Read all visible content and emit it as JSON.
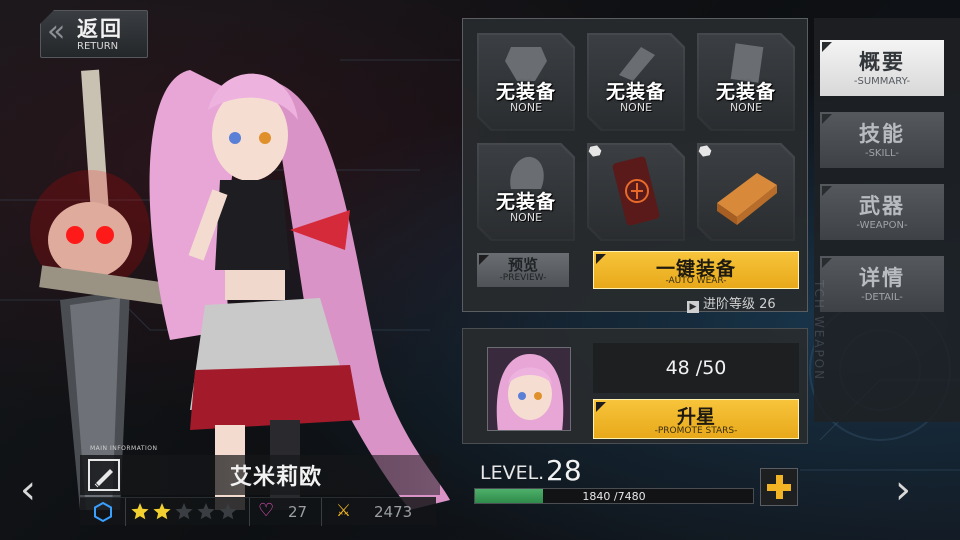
{
  "back_button": {
    "zh": "返回",
    "en": "RETURN"
  },
  "equipment": {
    "slots": [
      {
        "zh": "无装备",
        "en": "NONE",
        "icon": "armor-silhouette-icon",
        "empty": true
      },
      {
        "zh": "无装备",
        "en": "NONE",
        "icon": "gauntlet-silhouette-icon",
        "empty": true
      },
      {
        "zh": "无装备",
        "en": "NONE",
        "icon": "card-silhouette-icon",
        "empty": true
      },
      {
        "zh": "无装备",
        "en": "NONE",
        "icon": "helmet-silhouette-icon",
        "empty": true
      },
      {
        "icon": "red-rune-tablet-icon",
        "empty": false
      },
      {
        "icon": "brick-item-icon",
        "empty": false
      }
    ],
    "preview_button": {
      "zh": "预览",
      "en": "-PREVIEW-"
    },
    "auto_wear_button": {
      "zh": "一键装备",
      "en": "-AUTO WEAR-"
    },
    "advance_text": "进阶等级 26"
  },
  "stars": {
    "shards": "48 /50",
    "promote_button": {
      "zh": "升星",
      "en": "-PROMOTE STARS-"
    }
  },
  "level": {
    "label": "LEVEL.",
    "value": "28",
    "xp_text": "1840 /7480",
    "xp_fraction": 0.246
  },
  "character": {
    "main_info_label": "MAIN INFORMATION",
    "name": "艾米莉欧",
    "stars_filled": 2,
    "stars_total": 5,
    "affection": "27",
    "power": "2473"
  },
  "tabs": [
    {
      "zh": "概要",
      "en": "-SUMMARY-",
      "active": true
    },
    {
      "zh": "技能",
      "en": "-SKILL-",
      "active": false
    },
    {
      "zh": "武器",
      "en": "-WEAPON-",
      "active": false
    },
    {
      "zh": "详情",
      "en": "-DETAIL-",
      "active": false
    }
  ],
  "watermark": "TCH WEAPON",
  "colors": {
    "accent_gold": "#f2b424",
    "xp_green": "#3fa05c",
    "heart_pink": "#ff5ad2",
    "hex_blue": "#3aa0ff"
  }
}
